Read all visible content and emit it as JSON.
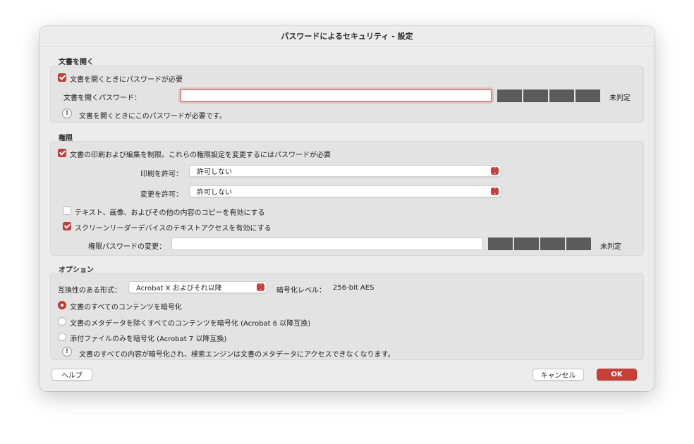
{
  "dialog": {
    "title": "パスワードによるセキュリティ - 設定"
  },
  "open_section": {
    "label": "文書を開く",
    "require_checkbox_label": "文書を開くときにパスワードが必要",
    "require_checked": true,
    "password_label": "文書を開くパスワード：",
    "password_value": "",
    "strength_label": "未判定",
    "info_text": "文書を開くときにこのパスワードが必要です。"
  },
  "permissions_section": {
    "label": "権限",
    "restrict_checkbox_label": "文書の印刷および編集を制限。これらの権限設定を変更するにはパスワードが必要",
    "restrict_checked": true,
    "print_label": "印刷を許可：",
    "print_value": "許可しない",
    "change_label": "変更を許可：",
    "change_value": "許可しない",
    "copy_checkbox_label": "テキスト、画像、およびその他の内容のコピーを有効にする",
    "copy_checked": false,
    "screenreader_checkbox_label": "スクリーンリーダーデバイスのテキストアクセスを有効にする",
    "screenreader_checked": true,
    "perm_password_label": "権限パスワードの変更：",
    "perm_password_value": "",
    "strength_label": "未判定"
  },
  "options_section": {
    "label": "オプション",
    "compat_label": "互換性のある形式：",
    "compat_value": "Acrobat X およびそれ以降",
    "encryption_label": "暗号化レベル：",
    "encryption_value": "256-bit AES",
    "radio_all": "文書のすべてのコンテンツを暗号化",
    "radio_except_metadata": "文書のメタデータを除くすべてのコンテンツを暗号化 (Acrobat 6 以降互換)",
    "radio_attachments": "添付ファイルのみを暗号化 (Acrobat 7 以降互換)",
    "selected_radio": "all",
    "info_text": "文書のすべての内容が暗号化され、検索エンジンは文書のメタデータにアクセスできなくなります。"
  },
  "buttons": {
    "help": "ヘルプ",
    "cancel": "キャンセル",
    "ok": "OK"
  },
  "colors": {
    "accent": "#c7403a",
    "meter": "#5b5b5b"
  },
  "icons": {
    "warning": "exclamation-icon",
    "checkbox_checked": "checkmark-icon",
    "select": "updown-chevron-icon"
  }
}
